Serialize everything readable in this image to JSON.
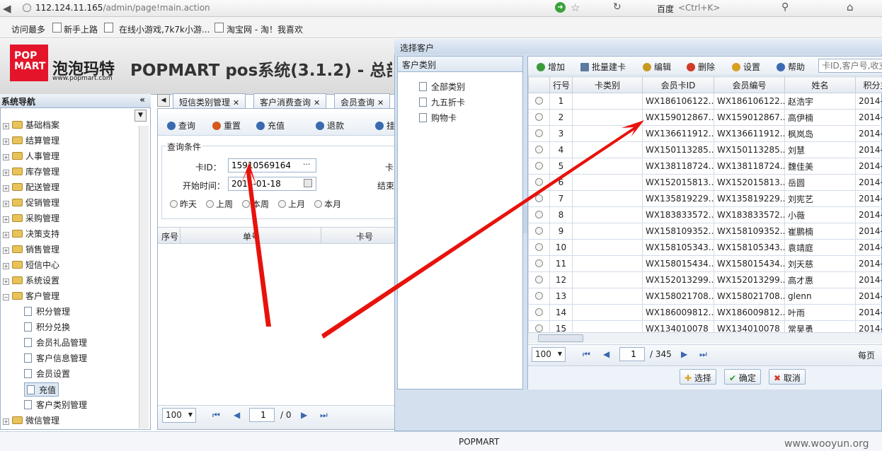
{
  "browser": {
    "url_host": "112.124.11.165",
    "url_path": "/admin/page!main.action",
    "search_engine": "百度",
    "search_placeholder": "<Ctrl+K>",
    "bookmarks": [
      "访问最多",
      "新手上路",
      "在线小游戏,7k7k小游...",
      "淘宝网 - 淘！我喜欢"
    ]
  },
  "app": {
    "logo_top": "POP",
    "logo_bottom": "MART",
    "brand": "泡泡玛特",
    "brand_url": "www.popmart.com",
    "title": "POPMART pos系统(3.1.2) - 总部",
    "footer": "POPMART"
  },
  "nav": {
    "title": "系统导航",
    "items": [
      "基础档案",
      "结算管理",
      "人事管理",
      "库存管理",
      "配送管理",
      "促销管理",
      "采购管理",
      "决策支持",
      "销售管理",
      "短信中心",
      "系统设置",
      "客户管理"
    ],
    "sub_items": [
      "积分管理",
      "积分兑换",
      "会员礼品管理",
      "客户信息管理",
      "会员设置",
      "充值",
      "客户类别管理"
    ],
    "last_item": "微信管理"
  },
  "tabs": [
    "短信类别管理",
    "客户消费查询",
    "会员查询"
  ],
  "toolbar": [
    "查询",
    "重置",
    "充值",
    "退款",
    "挂"
  ],
  "query": {
    "legend": "查询条件",
    "card_label": "卡ID：",
    "card_value": "15910569164",
    "card_suffix": "卡",
    "start_label": "开始时间：",
    "start_value": "2014-01-18",
    "end_label": "结束",
    "radios": [
      "昨天",
      "上周",
      "本周",
      "上月",
      "本月"
    ]
  },
  "left_grid": {
    "headers": [
      "序号",
      "单号",
      "卡号"
    ],
    "page_size": "100",
    "page": "1",
    "page_total": "/ 0"
  },
  "dialog": {
    "title": "选择客户",
    "cat_title": "客户类别",
    "categories": [
      "全部类别",
      "九五折卡",
      "购物卡"
    ],
    "toolbar": [
      "增加",
      "批量建卡",
      "编辑",
      "删除",
      "设置",
      "帮助"
    ],
    "search_placeholder": "卡ID,客户号,收支",
    "headers": [
      "行号",
      "卡类别",
      "会员卡ID",
      "会员编号",
      "姓名",
      "积分主"
    ],
    "rows": [
      [
        "1",
        "",
        "WX186106122...",
        "WX186106122...",
        "赵浩宇",
        "2014-0"
      ],
      [
        "2",
        "",
        "WX159012867...",
        "WX159012867...",
        "高伊楠",
        "2014-0"
      ],
      [
        "3",
        "",
        "WX136611912...",
        "WX136611912...",
        "枫岚岛",
        "2014-0"
      ],
      [
        "4",
        "",
        "WX150113285...",
        "WX150113285...",
        "刘慧",
        "2014-0"
      ],
      [
        "5",
        "",
        "WX138118724...",
        "WX138118724...",
        "魏佳美",
        "2014-0"
      ],
      [
        "6",
        "",
        "WX152015813...",
        "WX152015813...",
        "岳圆",
        "2014-0"
      ],
      [
        "7",
        "",
        "WX135819229...",
        "WX135819229...",
        "刘宪艺",
        "2014-0"
      ],
      [
        "8",
        "",
        "WX183833572...",
        "WX183833572...",
        "小薇",
        "2014-0"
      ],
      [
        "9",
        "",
        "WX158109352...",
        "WX158109352...",
        "崔鹏楠",
        "2014-0"
      ],
      [
        "10",
        "",
        "WX158105343...",
        "WX158105343...",
        "袁靖庭",
        "2014-0"
      ],
      [
        "11",
        "",
        "WX158015434...",
        "WX158015434...",
        "刘天慈",
        "2014-0"
      ],
      [
        "12",
        "",
        "WX152013299...",
        "WX152013299...",
        "高才惠",
        "2014-0"
      ],
      [
        "13",
        "",
        "WX158021708...",
        "WX158021708...",
        "glenn",
        "2014-0"
      ],
      [
        "14",
        "",
        "WX186009812...",
        "WX186009812...",
        "叶雨",
        "2014-0"
      ],
      [
        "15",
        "",
        "WX134010078",
        "WX134010078",
        "常昊勇",
        "2014-0"
      ]
    ],
    "page_size": "100",
    "page": "1",
    "page_total": "/ 345",
    "per_page_label": "每页",
    "buttons": [
      "选择",
      "确定",
      "取消"
    ]
  },
  "watermark": "www.wooyun.org",
  "colors": {
    "arrow": "#e8120c",
    "logo": "#e4152a",
    "border": "#99b3d0"
  }
}
